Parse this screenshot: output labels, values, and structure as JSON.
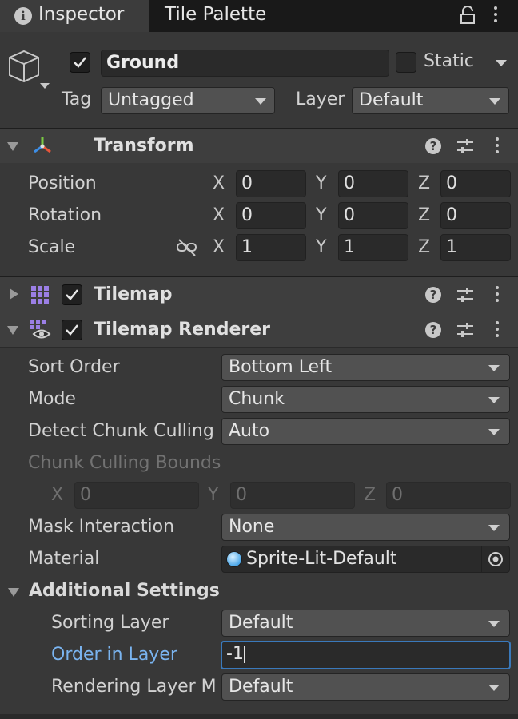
{
  "tabs": [
    {
      "label": "Inspector",
      "icon": "info-icon",
      "active": true
    },
    {
      "label": "Tile Palette",
      "active": false
    }
  ],
  "gameobject": {
    "active": true,
    "name": "Ground",
    "static_label": "Static",
    "static": false,
    "tag_label": "Tag",
    "tag_value": "Untagged",
    "layer_label": "Layer",
    "layer_value": "Default"
  },
  "transform": {
    "title": "Transform",
    "rows": [
      {
        "label": "Position",
        "x": "0",
        "y": "0",
        "z": "0"
      },
      {
        "label": "Rotation",
        "x": "0",
        "y": "0",
        "z": "0"
      },
      {
        "label": "Scale",
        "x": "1",
        "y": "1",
        "z": "1"
      }
    ],
    "axis": {
      "x": "X",
      "y": "Y",
      "z": "Z"
    }
  },
  "tilemap": {
    "title": "Tilemap",
    "enabled": true,
    "expanded": false
  },
  "tilemap_renderer": {
    "title": "Tilemap Renderer",
    "enabled": true,
    "sort_order_label": "Sort Order",
    "sort_order_value": "Bottom Left",
    "mode_label": "Mode",
    "mode_value": "Chunk",
    "detect_culling_label": "Detect Chunk Culling",
    "detect_culling_value": "Auto",
    "culling_bounds_label": "Chunk Culling Bounds",
    "culling_bounds": {
      "x": "0",
      "y": "0",
      "z": "0"
    },
    "mask_label": "Mask Interaction",
    "mask_value": "None",
    "material_label": "Material",
    "material_value": "Sprite-Lit-Default",
    "additional_label": "Additional Settings",
    "sorting_layer_label": "Sorting Layer",
    "sorting_layer_value": "Default",
    "order_label": "Order in Layer",
    "order_value": "-1",
    "rendering_layer_label": "Rendering Layer M",
    "rendering_layer_value": "Default"
  },
  "colors": {
    "accent": "#3a79bb",
    "focused_label": "#7ab4f0",
    "panel": "#383838",
    "tabbar": "#191919"
  }
}
